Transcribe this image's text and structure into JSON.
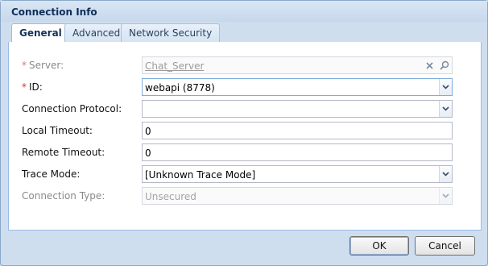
{
  "window": {
    "title": "Connection Info"
  },
  "tabs": [
    {
      "label": "General",
      "active": true
    },
    {
      "label": "Advanced",
      "active": false
    },
    {
      "label": "Network Security",
      "active": false
    }
  ],
  "form": {
    "server": {
      "label": "Server:",
      "required": true,
      "value": "Chat_Server",
      "disabled": true
    },
    "id": {
      "label": "ID:",
      "required": true,
      "value": "webapi (8778)"
    },
    "connection_protocol": {
      "label": "Connection Protocol:",
      "value": ""
    },
    "local_timeout": {
      "label": "Local Timeout:",
      "value": "0"
    },
    "remote_timeout": {
      "label": "Remote Timeout:",
      "value": "0"
    },
    "trace_mode": {
      "label": "Trace Mode:",
      "value": "[Unknown Trace Mode]"
    },
    "connection_type": {
      "label": "Connection Type:",
      "value": "Unsecured",
      "disabled": true
    },
    "required_marker": "*"
  },
  "buttons": {
    "ok": "OK",
    "cancel": "Cancel"
  },
  "icons": {
    "clear": "close-icon",
    "search": "search-icon",
    "dropdown": "chevron-down-icon"
  },
  "colors": {
    "accent": "#99bbe8",
    "title_text": "#0f2f59",
    "required": "#c0392b"
  }
}
